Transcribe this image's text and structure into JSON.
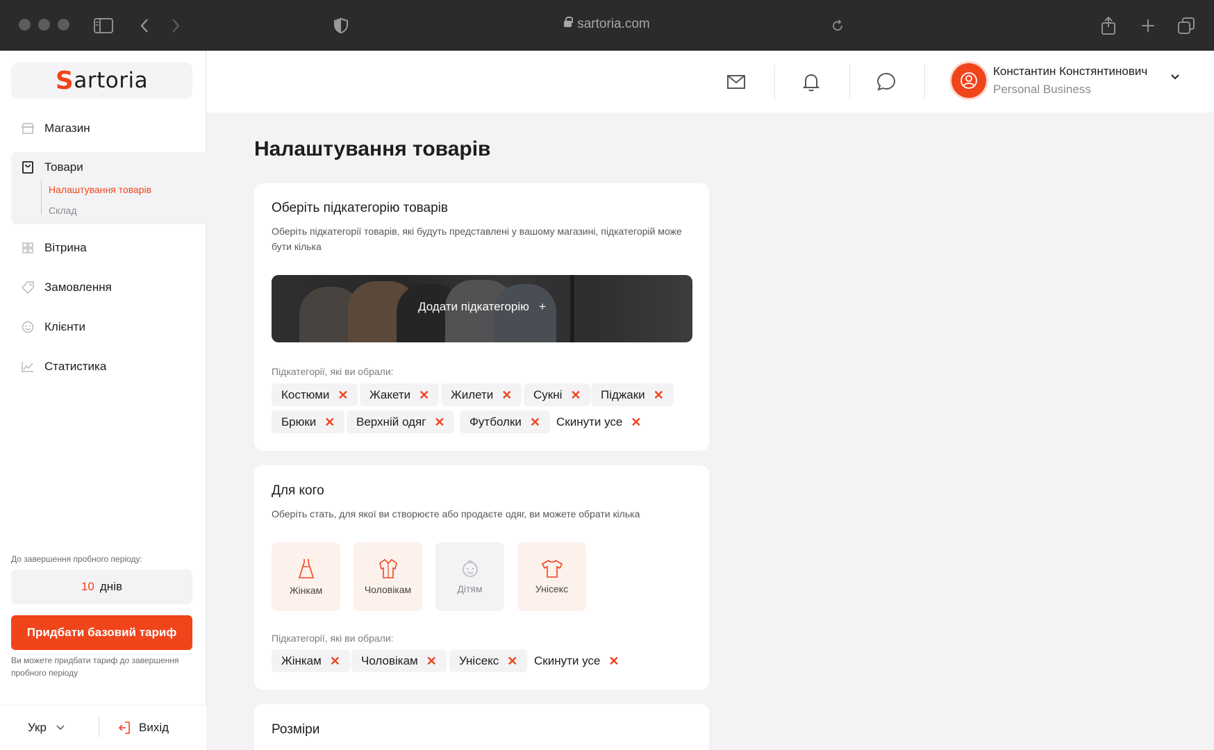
{
  "browser": {
    "url": "sartoria.com"
  },
  "logo": {
    "prefix": "S",
    "rest": "artoria"
  },
  "sidebar": {
    "items": [
      {
        "label": "Магазин",
        "icon": "store-icon"
      },
      {
        "label": "Товари",
        "icon": "bag-icon"
      },
      {
        "label": "Вітрина",
        "icon": "grid-icon"
      },
      {
        "label": "Замовлення",
        "icon": "tag-icon"
      },
      {
        "label": "Клієнти",
        "icon": "smile-icon"
      },
      {
        "label": "Статистика",
        "icon": "chart-icon"
      }
    ],
    "sub_items": [
      "Налаштування товарів",
      "Склад"
    ],
    "trial_label": "До завершення пробного періоду:",
    "trial_days": "10",
    "trial_unit": "днів",
    "buy_button": "Придбати базовий тариф",
    "buy_note": "Ви можете придбати тариф до завершення пробного періоду",
    "language": "Укр",
    "logout": "Вихід"
  },
  "header": {
    "user_name": "Константин Констянтинович",
    "user_role": "Personal Business"
  },
  "page_title": "Налаштування товарів",
  "subcategory_card": {
    "title": "Оберіть підкатегорію товарів",
    "description": "Оберіть підкатегорії товарів, які будуть представлені у вашому магазині, підкатегорій може бути кілька",
    "add_button": "Додати підкатегорію",
    "selected_label": "Підкатегорії, які ви обрали:",
    "chips": [
      "Костюми",
      "Жакети",
      "Жилети",
      "Сукні",
      "Піджаки",
      "Брюки",
      "Верхній одяг",
      "Футболки"
    ],
    "reset": "Скинути усе"
  },
  "audience_card": {
    "title": "Для кого",
    "description": "Оберіть стать, для якої ви створюєте або продаєте одяг, ви можете обрати кілька",
    "options": [
      {
        "label": "Жінкам",
        "icon": "dress-icon",
        "selected": true
      },
      {
        "label": "Чоловікам",
        "icon": "shirt-icon",
        "selected": true
      },
      {
        "label": "Дітям",
        "icon": "baby-icon",
        "selected": false
      },
      {
        "label": "Унісекс",
        "icon": "tshirt-icon",
        "selected": true
      }
    ],
    "selected_label": "Підкатегорії, які ви обрали:",
    "chips": [
      "Жінкам",
      "Чоловікам",
      "Унісекс"
    ],
    "reset": "Скинути усе"
  },
  "sizes_card": {
    "title": "Розміри"
  },
  "colors": {
    "accent": "#f0441b",
    "chrome": "#2b2b2d",
    "background": "#f3f3f5"
  }
}
